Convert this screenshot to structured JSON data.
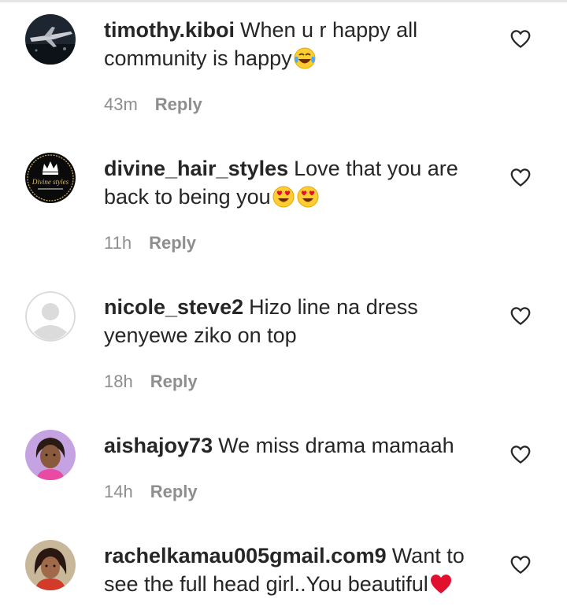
{
  "reply_label": "Reply",
  "comments": [
    {
      "username": "timothy.kiboi",
      "text": "When u r happy all community is happy",
      "emoji": "face-with-tears-of-joy",
      "time": "43m"
    },
    {
      "username": "divine_hair_styles",
      "text": "Love that you are back to being you",
      "emoji": "smiling-face-with-heart-eyes x2",
      "time": "11h",
      "avatar_text": "Divine styles"
    },
    {
      "username": "nicole_steve2",
      "text": "Hizo line na dress yenyewe ziko on top",
      "time": "18h"
    },
    {
      "username": "aishajoy73",
      "text": "We miss drama mamaah",
      "time": "14h"
    },
    {
      "username": "rachelkamau005gmail.com9",
      "text": "Want to see the full head girl..You beautiful",
      "emoji": "red-heart"
    }
  ],
  "icons": {
    "like": "heart-outline-icon"
  },
  "colors": {
    "text": "#262626",
    "meta": "#8e8e8e",
    "heart": "#e0102e"
  }
}
